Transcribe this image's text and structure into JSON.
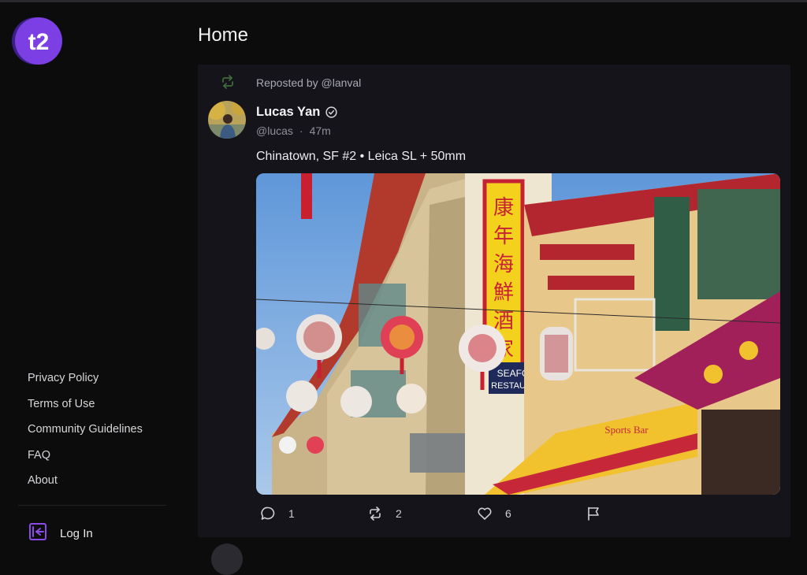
{
  "page": {
    "title": "Home"
  },
  "sidebar": {
    "logo_alt": "t2",
    "footer_links": [
      {
        "label": "Privacy Policy"
      },
      {
        "label": "Terms of Use"
      },
      {
        "label": "Community Guidelines"
      },
      {
        "label": "FAQ"
      },
      {
        "label": "About"
      }
    ],
    "login_label": "Log In"
  },
  "post": {
    "repost_label": "Reposted by @lanval",
    "author_name": "Lucas Yan",
    "author_handle": "@lucas",
    "separator": "·",
    "time_ago": "47m",
    "verified": true,
    "text": "Chinatown, SF #2 • Leica SL + 50mm",
    "image_content": "Chinatown street with red lanterns, pagoda-style buildings and signs",
    "actions": {
      "replies": "1",
      "reposts": "2",
      "likes": "6"
    }
  },
  "colors": {
    "accent": "#7b3fe4",
    "repost_green": "#3f6b3a",
    "background": "#0c0c0c",
    "card": "#14141a"
  }
}
